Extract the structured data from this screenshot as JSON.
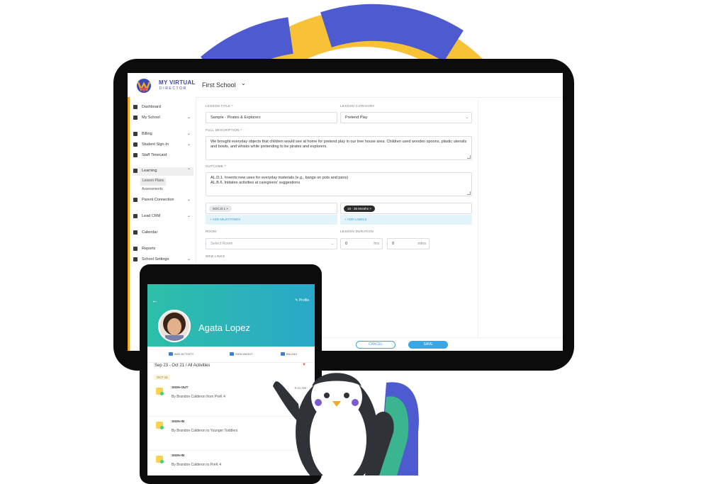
{
  "colors": {
    "ring_blue": "#4e5bd0",
    "ring_yellow": "#f7c236",
    "accent_orange": "#f4a82a",
    "teal_header": "#2dbfa8",
    "save_blue": "#3aa6e6",
    "chip_dark": "#2b2b2b"
  },
  "app": {
    "logo_line1": "MY VIRTUAL",
    "logo_line2": "DIRECTOR",
    "school_selector": "First School",
    "school_chevron": "chevron-down-icon"
  },
  "sidebar": {
    "items": [
      {
        "label": "Dashboard",
        "icon": "dashboard-icon",
        "chevron": ""
      },
      {
        "label": "My School",
        "icon": "school-icon",
        "chevron": "⌄"
      },
      {
        "label": "Billing",
        "icon": "billing-icon",
        "chevron": "⌄"
      },
      {
        "label": "Student Sign-In",
        "icon": "signin-icon",
        "chevron": "⌄"
      },
      {
        "label": "Staff Timecard",
        "icon": "timecard-icon",
        "chevron": ""
      },
      {
        "label": "Learning",
        "icon": "learning-icon",
        "chevron": "⌃"
      },
      {
        "label": "Parent Connection",
        "icon": "parent-icon",
        "chevron": "⌄"
      },
      {
        "label": "Lead CRM",
        "icon": "crm-icon",
        "chevron": "⌄"
      },
      {
        "label": "Calendar",
        "icon": "calendar-icon",
        "chevron": ""
      },
      {
        "label": "Reports",
        "icon": "reports-icon",
        "chevron": ""
      },
      {
        "label": "School Settings",
        "icon": "settings-icon",
        "chevron": "⌄"
      }
    ],
    "sub_items": [
      {
        "label": "Lesson Plans"
      },
      {
        "label": "Assessments"
      }
    ]
  },
  "form": {
    "lesson_title_label": "LESSON TITLE",
    "lesson_title_value": "Sample - Pirates & Explorers",
    "lesson_category_label": "LESSON CATEGORY",
    "lesson_category_value": "Pretend Play",
    "full_description_label": "FULL DESCRIPTION",
    "full_description_value": "We brought everyday objects that children would see at home for pretend play in our tree house area. Children used wooden spoons, plastic utensils and bowls, and whisks while pretending to be pirates and explorers.",
    "outcome_label": "OUTCOME",
    "outcome_line1": "AL.D.1. Invents new uses for everyday materials (e.g., bangs on pots and pans)",
    "outcome_line2": "AL.B.6. Initiates activities at caregivers' suggestions",
    "milestone_chip": "SOC.D.1",
    "label_chip": "18 - 36 Months",
    "add_milestones": "+ ADD MILESTONES",
    "add_labels": "+ ADD LABELS",
    "room_label": "ROOM",
    "room_placeholder": "Select Room",
    "duration_label": "LESSON DURATION",
    "duration_hrs_value": "0",
    "duration_hrs_unit": "hrs",
    "duration_mins_value": "0",
    "duration_mins_unit": "mins",
    "weblinks_label": "WEB LINKS",
    "required_mark": "*",
    "cancel_label": "CANCEL",
    "save_label": "SAVE"
  },
  "tablet": {
    "back_icon": "back-arrow-icon",
    "profile_label": "✎ Profile",
    "child_name": "Agata Lopez",
    "actions": [
      {
        "label": "ADD ACTIVITY",
        "icon": "activity-icon"
      },
      {
        "label": "SIGN IN/OUT",
        "icon": "signinout-icon"
      },
      {
        "label": "BILLING",
        "icon": "billing-icon"
      }
    ],
    "filter_text": "Sep 23 - Oct 21 / All Activities",
    "filter_icon": "filter-icon",
    "date_badge": "OCT 16",
    "activities": [
      {
        "title": "SIGN-OUT",
        "subtitle": "By Brandon Calderon from PreK 4",
        "time": "9:41 AM"
      },
      {
        "title": "SIGN-IN",
        "subtitle": "By Brandon Calderon to Younger Toddlers",
        "time": ""
      },
      {
        "title": "SIGN-IN",
        "subtitle": "By Brandon Calderon to PreK 4",
        "time": ""
      }
    ]
  }
}
